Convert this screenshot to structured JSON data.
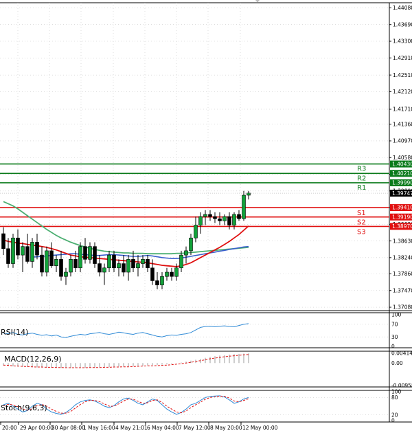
{
  "chart_data": {
    "type": "candlestick",
    "instrument_panel": {
      "price_ticks": [
        "1.44080",
        "1.43690",
        "1.43300",
        "1.42910",
        "1.42510",
        "1.42120",
        "1.41710",
        "1.41360",
        "1.40970",
        "1.40580",
        "1.40190",
        "1.39800",
        "1.39410",
        "1.39020",
        "1.38630",
        "1.38240",
        "1.37860",
        "1.37470",
        "1.37080"
      ],
      "ylim": [
        1.37,
        1.442
      ],
      "current_price": "1.39747",
      "levels": [
        {
          "name": "R3",
          "value": 1.4043,
          "label": "1.40430",
          "kind": "resistance"
        },
        {
          "name": "R2",
          "value": 1.4021,
          "label": "1.40210",
          "kind": "resistance"
        },
        {
          "name": "R1",
          "value": 1.3999,
          "label": "1.39990",
          "kind": "resistance"
        },
        {
          "name": "S1",
          "value": 1.3941,
          "label": "1.39410",
          "kind": "support"
        },
        {
          "name": "S2",
          "value": 1.3919,
          "label": "1.39190",
          "kind": "support"
        },
        {
          "name": "S3",
          "value": 1.3897,
          "label": "1.38970",
          "kind": "support"
        }
      ],
      "candles": [
        [
          1.388,
          1.3895,
          1.383,
          1.3845
        ],
        [
          1.3845,
          1.387,
          1.38,
          1.381
        ],
        [
          1.381,
          1.388,
          1.38,
          1.387
        ],
        [
          1.387,
          1.389,
          1.382,
          1.383
        ],
        [
          1.383,
          1.386,
          1.379,
          1.385
        ],
        [
          1.385,
          1.388,
          1.381,
          1.3815
        ],
        [
          1.3815,
          1.387,
          1.38,
          1.386
        ],
        [
          1.386,
          1.388,
          1.382,
          1.383
        ],
        [
          1.383,
          1.385,
          1.378,
          1.379
        ],
        [
          1.379,
          1.385,
          1.378,
          1.384
        ],
        [
          1.384,
          1.386,
          1.38,
          1.3805
        ],
        [
          1.3805,
          1.383,
          1.379,
          1.382
        ],
        [
          1.382,
          1.384,
          1.377,
          1.378
        ],
        [
          1.378,
          1.38,
          1.376,
          1.379
        ],
        [
          1.379,
          1.383,
          1.378,
          1.382
        ],
        [
          1.382,
          1.384,
          1.379,
          1.38
        ],
        [
          1.38,
          1.386,
          1.379,
          1.385
        ],
        [
          1.385,
          1.387,
          1.381,
          1.382
        ],
        [
          1.382,
          1.386,
          1.381,
          1.385
        ],
        [
          1.385,
          1.386,
          1.38,
          1.381
        ],
        [
          1.381,
          1.383,
          1.378,
          1.379
        ],
        [
          1.379,
          1.381,
          1.376,
          1.38
        ],
        [
          1.38,
          1.384,
          1.379,
          1.383
        ],
        [
          1.383,
          1.384,
          1.379,
          1.38
        ],
        [
          1.38,
          1.382,
          1.378,
          1.381
        ],
        [
          1.381,
          1.383,
          1.378,
          1.379
        ],
        [
          1.379,
          1.383,
          1.377,
          1.382
        ],
        [
          1.382,
          1.384,
          1.379,
          1.38
        ],
        [
          1.38,
          1.383,
          1.378,
          1.381
        ],
        [
          1.381,
          1.383,
          1.38,
          1.382
        ],
        [
          1.382,
          1.383,
          1.379,
          1.38
        ],
        [
          1.38,
          1.382,
          1.376,
          1.377
        ],
        [
          1.377,
          1.379,
          1.375,
          1.376
        ],
        [
          1.376,
          1.379,
          1.375,
          1.378
        ],
        [
          1.378,
          1.38,
          1.377,
          1.379
        ],
        [
          1.379,
          1.38,
          1.377,
          1.378
        ],
        [
          1.378,
          1.381,
          1.377,
          1.38
        ],
        [
          1.38,
          1.384,
          1.379,
          1.383
        ],
        [
          1.383,
          1.385,
          1.381,
          1.384
        ],
        [
          1.384,
          1.388,
          1.383,
          1.387
        ],
        [
          1.387,
          1.392,
          1.386,
          1.39
        ],
        [
          1.39,
          1.393,
          1.388,
          1.392
        ],
        [
          1.392,
          1.3935,
          1.39,
          1.3925
        ],
        [
          1.3925,
          1.3935,
          1.391,
          1.392
        ],
        [
          1.392,
          1.393,
          1.3905,
          1.3915
        ],
        [
          1.3915,
          1.393,
          1.39,
          1.391
        ],
        [
          1.391,
          1.3925,
          1.39,
          1.392
        ],
        [
          1.392,
          1.393,
          1.389,
          1.39
        ],
        [
          1.39,
          1.393,
          1.389,
          1.3925
        ],
        [
          1.3925,
          1.3935,
          1.391,
          1.3915
        ],
        [
          1.3915,
          1.398,
          1.391,
          1.397
        ],
        [
          1.397,
          1.398,
          1.396,
          1.3975
        ]
      ],
      "ma_red": [
        1.3865,
        1.3862,
        1.386,
        1.3858,
        1.3857,
        1.3855,
        1.3853,
        1.3852,
        1.385,
        1.3848,
        1.3845,
        1.3842,
        1.3838,
        1.3834,
        1.383,
        1.3828,
        1.3826,
        1.3825,
        1.3824,
        1.3823,
        1.3822,
        1.3821,
        1.382,
        1.3819,
        1.3818,
        1.3817,
        1.3816,
        1.3815,
        1.3814,
        1.3813,
        1.3812,
        1.381,
        1.3808,
        1.3806,
        1.3805,
        1.3804,
        1.3803,
        1.3805,
        1.3808,
        1.3812,
        1.3818,
        1.3824,
        1.383,
        1.3836,
        1.3842,
        1.3848,
        1.3855,
        1.3862,
        1.387,
        1.3878,
        1.3888,
        1.3898
      ],
      "ma_blue": [
        null,
        null,
        null,
        null,
        null,
        null,
        1.3825,
        1.3826,
        1.3827,
        1.3828,
        1.3829,
        1.383,
        1.3831,
        1.3832,
        1.3833,
        1.3833,
        1.3832,
        1.3831,
        1.383,
        1.3829,
        1.3829,
        1.383,
        1.3831,
        1.3831,
        1.383,
        1.3829,
        1.3828,
        1.3827,
        1.3827,
        1.3828,
        1.3829,
        1.3828,
        1.3826,
        1.3824,
        1.3823,
        1.3822,
        1.3822,
        1.3823,
        1.3825,
        1.3827,
        1.3829,
        1.3831,
        1.3833,
        1.3835,
        1.3837,
        1.3839,
        1.3841,
        1.3843,
        1.3845,
        1.3847,
        1.3849,
        1.385
      ],
      "ma_green": [
        1.3955,
        1.395,
        1.3945,
        1.3938,
        1.393,
        1.3922,
        1.3914,
        1.3906,
        1.3898,
        1.389,
        1.3883,
        1.3876,
        1.387,
        1.3865,
        1.386,
        1.3856,
        1.3852,
        1.3849,
        1.3846,
        1.3843,
        1.3841,
        1.3839,
        1.3838,
        1.3837,
        1.3836,
        1.3835,
        1.3835,
        1.3834,
        1.3834,
        1.3834,
        1.3833,
        1.3833,
        1.3833,
        1.3833,
        1.3833,
        1.3833,
        1.3834,
        1.3834,
        1.3835,
        1.3836,
        1.3837,
        1.3838,
        1.3839,
        1.384,
        1.3841,
        1.3842,
        1.3843,
        1.3844,
        1.3845,
        1.3846,
        1.3847,
        1.3848
      ]
    },
    "rsi_panel": {
      "title": "RSI(14)",
      "ticks": [
        "100",
        "70",
        "30",
        "0"
      ],
      "ylim": [
        0,
        100
      ],
      "values": [
        42,
        40,
        44,
        38,
        36,
        40,
        42,
        38,
        35,
        37,
        33,
        36,
        30,
        28,
        32,
        35,
        38,
        36,
        40,
        42,
        44,
        40,
        38,
        41,
        45,
        43,
        40,
        38,
        42,
        44,
        40,
        36,
        32,
        30,
        34,
        36,
        35,
        38,
        40,
        44,
        52,
        60,
        63,
        64,
        62,
        64,
        65,
        63,
        62,
        66,
        70,
        72
      ]
    },
    "macd_panel": {
      "title": "MACD(12,26,9)",
      "ticks": [
        "0.004149",
        "0.00",
        "-0.009585"
      ],
      "ylim": [
        -0.009585,
        0.004149
      ],
      "histogram": [
        -0.001,
        -0.0012,
        -0.0014,
        -0.0015,
        -0.0016,
        -0.0017,
        -0.0018,
        -0.0018,
        -0.0019,
        -0.0019,
        -0.002,
        -0.002,
        -0.0021,
        -0.0021,
        -0.0021,
        -0.0021,
        -0.002,
        -0.002,
        -0.0019,
        -0.0019,
        -0.0018,
        -0.0018,
        -0.0017,
        -0.0016,
        -0.0015,
        -0.0015,
        -0.0014,
        -0.0013,
        -0.0012,
        -0.0011,
        -0.001,
        -0.0009,
        -0.0008,
        -0.0007,
        -0.0005,
        -0.0003,
        -0.0001,
        0.0002,
        0.0006,
        0.001,
        0.0014,
        0.0018,
        0.0022,
        0.0026,
        0.0029,
        0.0032,
        0.0034,
        0.0036,
        0.0038,
        0.0039,
        0.004,
        0.0041
      ],
      "signal": [
        -0.0009,
        -0.001,
        -0.0012,
        -0.0013,
        -0.0014,
        -0.0015,
        -0.0016,
        -0.0017,
        -0.0017,
        -0.0018,
        -0.0018,
        -0.0019,
        -0.0019,
        -0.002,
        -0.002,
        -0.002,
        -0.002,
        -0.002,
        -0.0019,
        -0.0019,
        -0.0019,
        -0.0018,
        -0.0018,
        -0.0017,
        -0.0017,
        -0.0016,
        -0.0016,
        -0.0015,
        -0.0014,
        -0.0013,
        -0.0012,
        -0.0012,
        -0.0011,
        -0.001,
        -0.0009,
        -0.0007,
        -0.0005,
        -0.0003,
        0.0,
        0.0003,
        0.0007,
        0.001,
        0.0014,
        0.0018,
        0.0021,
        0.0024,
        0.0027,
        0.0029,
        0.0031,
        0.0033,
        0.0035,
        0.0036
      ]
    },
    "stoch_panel": {
      "title": "Stoch(9,6,3)",
      "ticks": [
        "100",
        "80",
        "20",
        "0"
      ],
      "ylim": [
        0,
        100
      ],
      "main": [
        55,
        60,
        50,
        40,
        30,
        35,
        50,
        60,
        55,
        40,
        30,
        25,
        22,
        28,
        40,
        55,
        65,
        70,
        72,
        68,
        60,
        50,
        45,
        52,
        65,
        75,
        78,
        70,
        60,
        55,
        65,
        75,
        70,
        55,
        40,
        30,
        22,
        28,
        40,
        55,
        60,
        70,
        80,
        84,
        85,
        86,
        82,
        72,
        60,
        65,
        75,
        80
      ],
      "signal": [
        52,
        56,
        55,
        48,
        40,
        36,
        42,
        52,
        56,
        50,
        40,
        32,
        26,
        26,
        32,
        44,
        56,
        65,
        70,
        70,
        66,
        58,
        50,
        50,
        58,
        68,
        75,
        74,
        67,
        60,
        62,
        70,
        72,
        63,
        50,
        40,
        30,
        27,
        33,
        45,
        55,
        64,
        74,
        80,
        83,
        85,
        84,
        78,
        68,
        65,
        70,
        76
      ]
    },
    "x_ticks": [
      "20:00",
      "29 Apr 00:00",
      "30 Apr 08:00",
      "1 May 16:00",
      "4 May 21:01",
      "6 May 04:00",
      "7 May 12:00",
      "8 May 20:00",
      "12 May 00:00"
    ]
  }
}
